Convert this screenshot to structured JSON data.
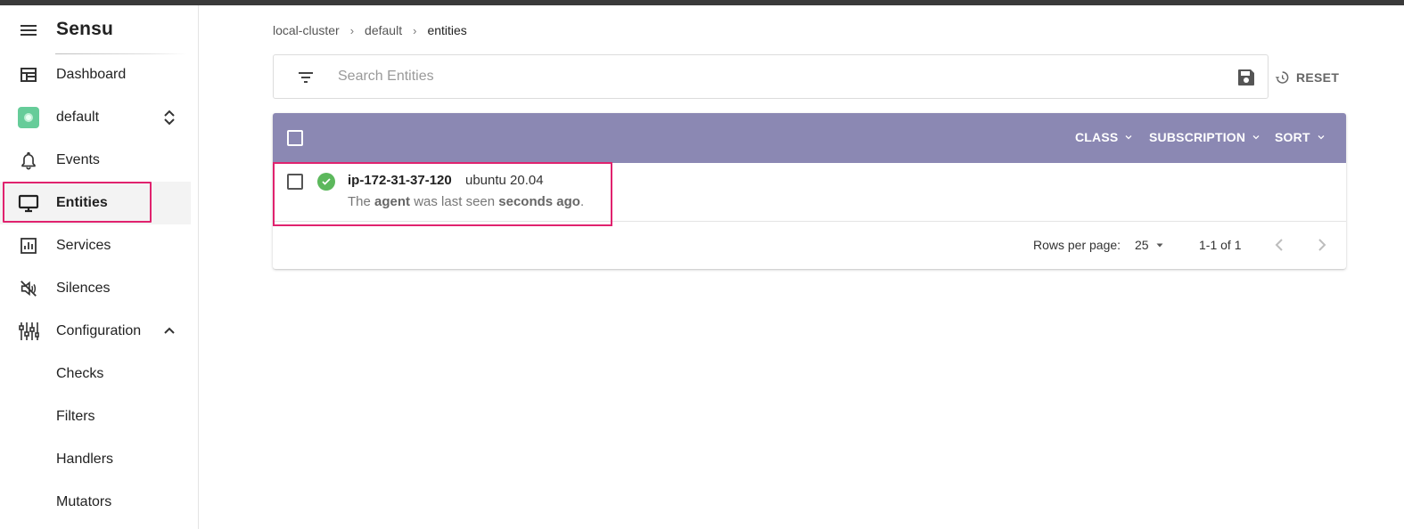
{
  "app": {
    "name": "Sensu"
  },
  "sidebar": {
    "items": [
      {
        "label": "Dashboard",
        "icon": "dashboard-icon"
      },
      {
        "label": "default",
        "icon": "namespace-icon"
      },
      {
        "label": "Events",
        "icon": "bell-icon"
      },
      {
        "label": "Entities",
        "icon": "monitor-icon",
        "active": true
      },
      {
        "label": "Services",
        "icon": "bar-chart-icon"
      },
      {
        "label": "Silences",
        "icon": "volume-off-icon"
      },
      {
        "label": "Configuration",
        "icon": "tune-icon"
      },
      {
        "label": "Checks"
      },
      {
        "label": "Filters"
      },
      {
        "label": "Handlers"
      },
      {
        "label": "Mutators"
      }
    ]
  },
  "breadcrumb": {
    "items": [
      "local-cluster",
      "default",
      "entities"
    ]
  },
  "search": {
    "placeholder": "Search Entities",
    "value": ""
  },
  "toolbar": {
    "reset_label": "RESET"
  },
  "table": {
    "header_menus": [
      "CLASS",
      "SUBSCRIPTION",
      "SORT"
    ],
    "rows": [
      {
        "name": "ip-172-31-37-120",
        "os": "ubuntu 20.04",
        "seen_prefix": "The",
        "seen_class": "agent",
        "seen_middle": "was last seen",
        "seen_time": "seconds ago",
        "seen_suffix": ".",
        "status": "ok"
      }
    ],
    "pagination": {
      "rows_label": "Rows per page:",
      "rows_value": "25",
      "range": "1-1 of 1"
    }
  },
  "colors": {
    "header": "#8b88b3",
    "status_ok": "#5cb85c",
    "highlight": "#e0226e",
    "namespace": "#66cc99"
  }
}
